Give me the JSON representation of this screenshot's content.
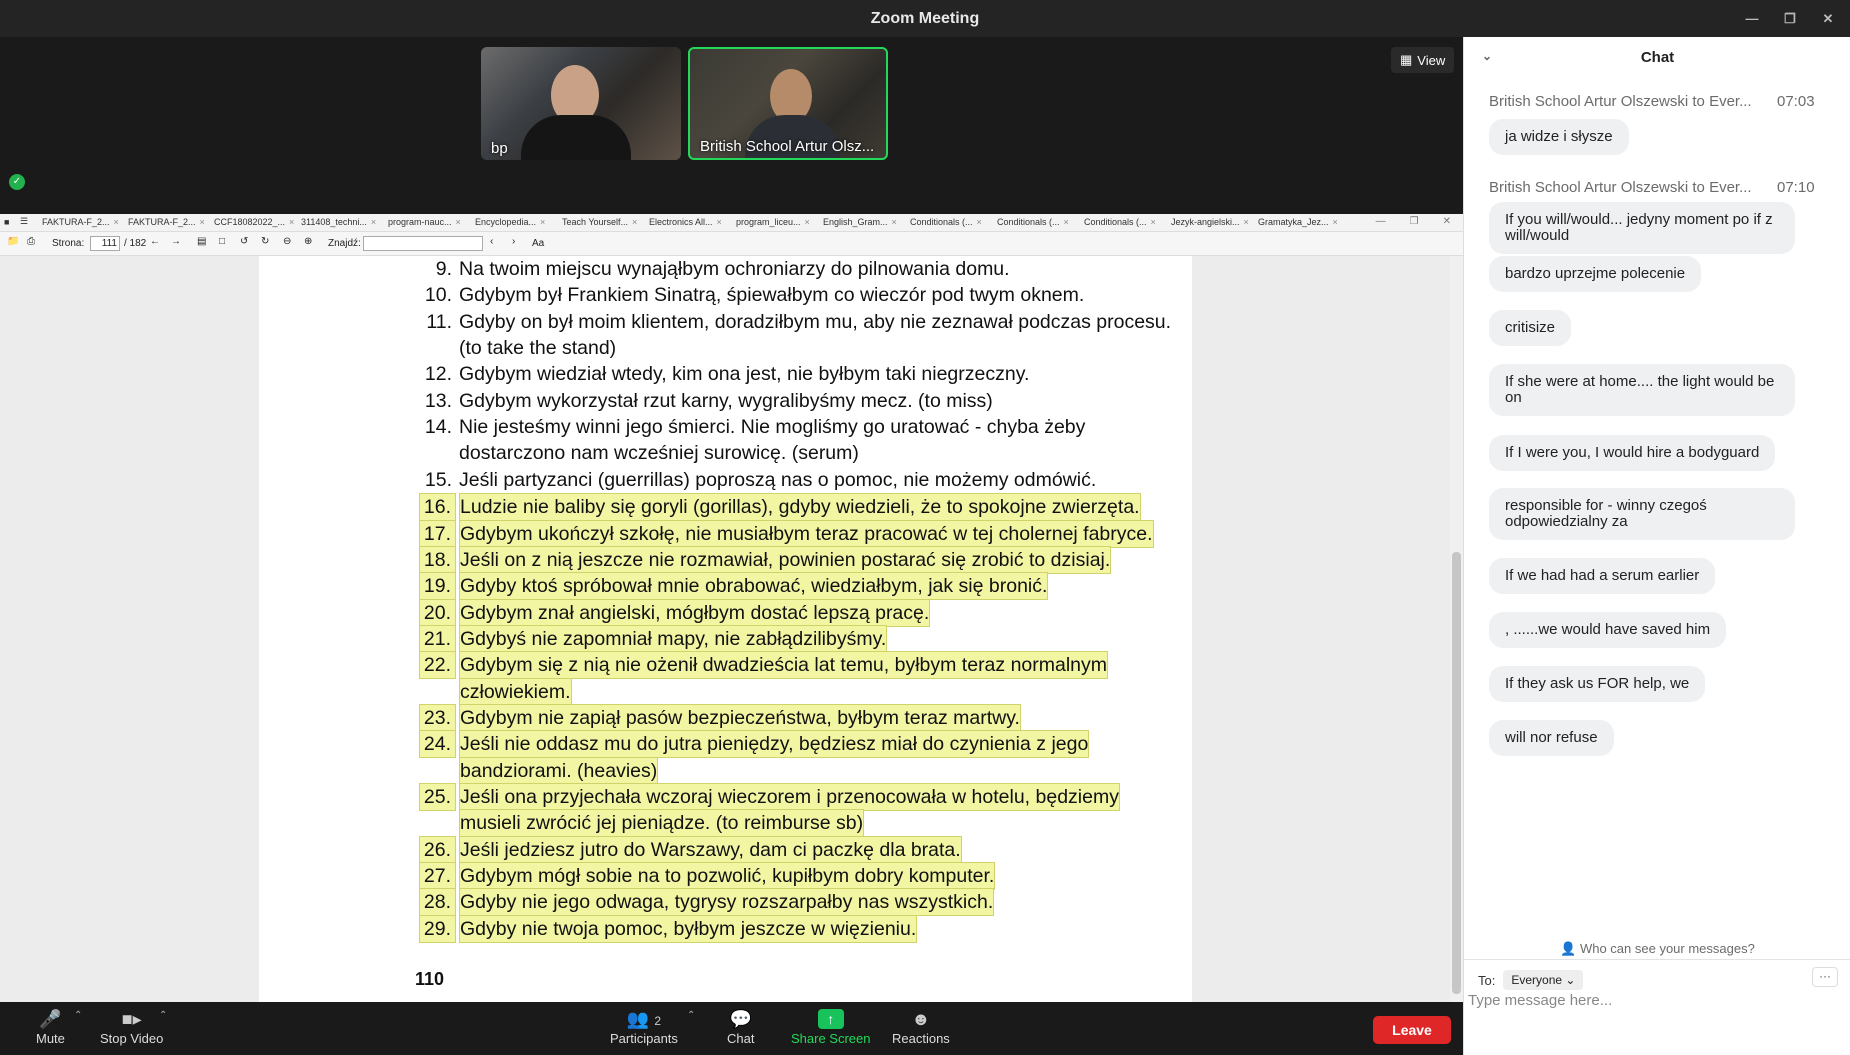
{
  "window": {
    "title": "Zoom Meeting",
    "controls": [
      "minimize-icon",
      "restore-icon",
      "close-icon"
    ]
  },
  "participants": [
    {
      "name": "bp"
    },
    {
      "name": "British School Artur Olsz...",
      "active_speaker_color": "#23d959"
    }
  ],
  "view_button": {
    "label": "View"
  },
  "pdf": {
    "tabs": [
      "FAKTURA-F_2...",
      "FAKTURA-F_2...",
      "CCF18082022_...",
      "311408_techni...",
      "program-nauc...",
      "Encyclopedia...",
      "Teach Yourself...",
      "Electronics All...",
      "program_liceu...",
      "English_Gram...",
      "Conditionals (...",
      "Conditionals (...",
      "Conditionals (...",
      "Jezyk-angielski...",
      "Gramatyka_Jez..."
    ],
    "toolbar": {
      "page_label": "Strona:",
      "page_current": "111",
      "page_total": "/ 182",
      "find_label": "Znajdź:",
      "find_placeholder": "",
      "case_label": "Aa"
    },
    "highlight_color": "#f2f5a2",
    "lines": [
      {
        "num": "9.",
        "text": "Na twoim miejscu wynająłbym ochroniarzy do pilnowania domu.",
        "hl": false
      },
      {
        "num": "10.",
        "text": "Gdybym był Frankiem Sinatrą, śpiewałbym co wieczór pod twym oknem.",
        "hl": false
      },
      {
        "num": "11.",
        "text": "Gdyby on był moim klientem, doradziłbym mu, aby nie zeznawał podczas procesu.",
        "hl": false
      },
      {
        "num": "",
        "text": "(to take the stand)",
        "hl": false
      },
      {
        "num": "12.",
        "text": "Gdybym wiedział wtedy, kim ona jest, nie byłbym taki niegrzeczny.",
        "hl": false
      },
      {
        "num": "13.",
        "text": "Gdybym wykorzystał rzut karny, wygralibyśmy mecz. (to miss)",
        "hl": false
      },
      {
        "num": "14.",
        "text": "Nie jesteśmy winni jego śmierci. Nie mogliśmy go uratować - chyba żeby",
        "hl": false
      },
      {
        "num": "",
        "text": "dostarczono nam wcześniej surowicę. (serum)",
        "hl": false
      },
      {
        "num": "15.",
        "text": "Jeśli partyzanci (guerrillas) poproszą nas o pomoc, nie możemy odmówić.",
        "hl": false
      },
      {
        "num": "16.",
        "text": "Ludzie nie baliby się goryli (gorillas), gdyby wiedzieli, że to spokojne zwierzęta.",
        "hl": true
      },
      {
        "num": "17.",
        "text": "Gdybym ukończył szkołę, nie musiałbym teraz pracować w tej cholernej fabryce.",
        "hl": true
      },
      {
        "num": "18.",
        "text": "Jeśli on z nią jeszcze nie rozmawiał, powinien postarać się zrobić to dzisiaj.",
        "hl": true
      },
      {
        "num": "19.",
        "text": "Gdyby ktoś spróbował mnie obrabować, wiedziałbym, jak się bronić.",
        "hl": true
      },
      {
        "num": "20.",
        "text": "Gdybym znał angielski, mógłbym dostać lepszą pracę.",
        "hl": true
      },
      {
        "num": "21.",
        "text": "Gdybyś nie zapomniał mapy, nie zabłądzilibyśmy.",
        "hl": true
      },
      {
        "num": "22.",
        "text": "Gdybym się z nią nie ożenił dwadzieścia lat temu, byłbym teraz normalnym",
        "hl": true
      },
      {
        "num": "",
        "text": "człowiekiem.",
        "hl": true
      },
      {
        "num": "23.",
        "text": "Gdybym nie zapiął pasów bezpieczeństwa, byłbym teraz martwy.",
        "hl": true
      },
      {
        "num": "24.",
        "text": "Jeśli nie oddasz mu do jutra pieniędzy, będziesz miał do czynienia z jego",
        "hl": true
      },
      {
        "num": "",
        "text": "bandziorami. (heavies)",
        "hl": true
      },
      {
        "num": "25.",
        "text": "Jeśli ona przyjechała wczoraj wieczorem i przenocowała w hotelu, będziemy",
        "hl": true
      },
      {
        "num": "",
        "text": "musieli zwrócić jej pieniądze. (to reimburse sb)",
        "hl": true
      },
      {
        "num": "26.",
        "text": "Jeśli jedziesz jutro do Warszawy, dam ci paczkę dla brata.",
        "hl": true
      },
      {
        "num": "27.",
        "text": "Gdybym mógł sobie na to pozwolić, kupiłbym dobry komputer.",
        "hl": true
      },
      {
        "num": "28.",
        "text": "Gdyby nie jego odwaga, tygrysy rozszarpałby nas wszystkich.",
        "hl": true
      },
      {
        "num": "29.",
        "text": "Gdyby nie twoja pomoc, byłbym jeszcze w więzieniu.",
        "hl": true
      }
    ],
    "page_number": "110"
  },
  "chat": {
    "title": "Chat",
    "groups": [
      {
        "sender": "British School Artur Olszewski to Ever...",
        "time": "07:03",
        "messages": [
          "ja widze i słysze"
        ]
      },
      {
        "sender": "British School Artur Olszewski to Ever...",
        "time": "07:10",
        "messages": [
          "If you will/would... jedyny moment po if z will/would",
          "bardzo uprzejme polecenie",
          "critisize",
          "If she were at home.... the light would be on",
          "If I were you, I would hire a bodyguard",
          "responsible for - winny czegoś odpowiedzialny za",
          "If we had had a serum earlier",
          ", ......we would have saved him",
          "If they ask us FOR help, we",
          "will nor refuse"
        ]
      }
    ],
    "who_can_see": "Who can see your messages?",
    "to_label": "To:",
    "to_value": "Everyone",
    "more_label": "···",
    "input_placeholder": "Type message here..."
  },
  "controls": {
    "mute": "Mute",
    "stop_video": "Stop Video",
    "participants": "Participants",
    "participants_count": "2",
    "chat": "Chat",
    "share_screen": "Share Screen",
    "reactions": "Reactions",
    "leave": "Leave",
    "leave_color": "#e02727",
    "share_color": "#23d959"
  }
}
